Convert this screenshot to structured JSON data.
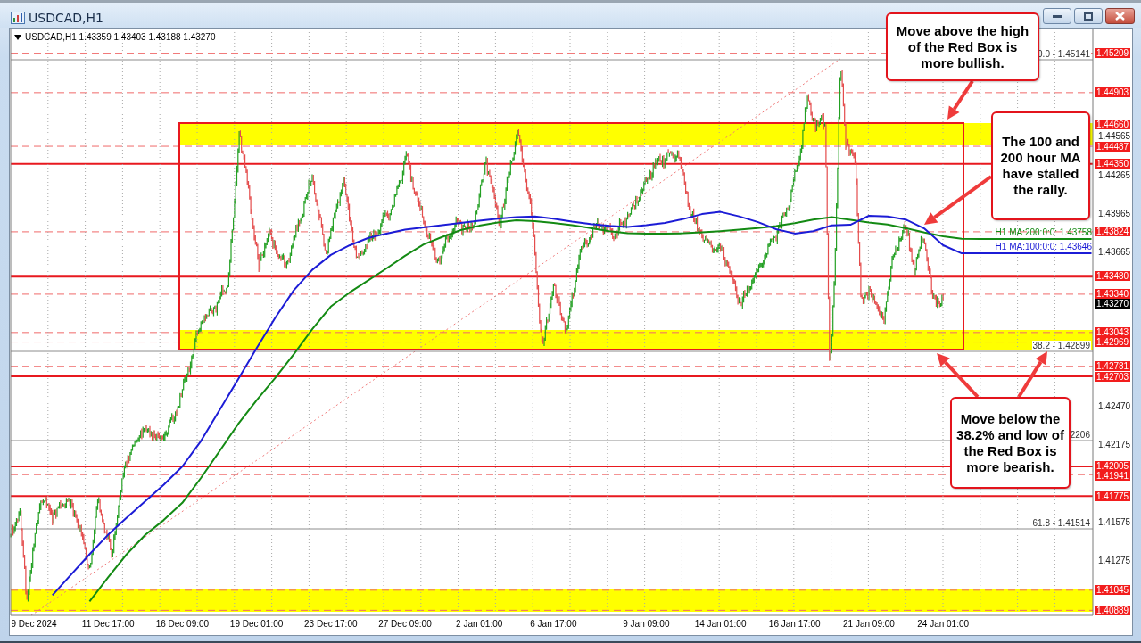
{
  "window": {
    "title": "USDCAD,H1"
  },
  "chart": {
    "info": "USDCAD,H1 1.43359 1.43403 1.43188 1.43270",
    "price_levels": [
      {
        "text": "1.45209",
        "kind": "dashed"
      },
      {
        "text": "1.44903",
        "kind": "dashed"
      },
      {
        "text": "1.44660",
        "kind": "marker"
      },
      {
        "text": "1.44487",
        "kind": "dashed"
      },
      {
        "text": "1.44350",
        "kind": "solid"
      },
      {
        "text": "1.43824",
        "kind": "dashed"
      },
      {
        "text": "1.43480",
        "kind": "thick"
      },
      {
        "text": "1.43340",
        "kind": "dashed"
      },
      {
        "text": "1.43270",
        "kind": "current"
      },
      {
        "text": "1.43043",
        "kind": "dashed"
      },
      {
        "text": "1.42969",
        "kind": "dashed"
      },
      {
        "text": "1.42781",
        "kind": "dashed"
      },
      {
        "text": "1.42703",
        "kind": "solid"
      },
      {
        "text": "1.42005",
        "kind": "solid"
      },
      {
        "text": "1.41941",
        "kind": "dashed"
      },
      {
        "text": "1.41775",
        "kind": "solid"
      },
      {
        "text": "1.41045",
        "kind": "dashed"
      },
      {
        "text": "1.40889",
        "kind": "dashed"
      }
    ],
    "fibonacci_levels": [
      "0.0 - 1.45141",
      "38.2 - 1.42899",
      "2206",
      "61.8 - 1.41514"
    ],
    "chart_data": {
      "type": "line",
      "grid": true,
      "ylim": [
        1.4085,
        1.454
      ],
      "categories": [
        "9 Dec 2024",
        null,
        null,
        null,
        "11 Dec 17:00",
        null,
        null,
        null,
        "16 Dec 09:00",
        null,
        null,
        null,
        "19 Dec 01:00",
        null,
        null,
        null,
        "23 Dec 17:00",
        null,
        null,
        null,
        "27 Dec 09:00",
        null,
        null,
        null,
        "2 Jan 01:00",
        null,
        null,
        null,
        "6 Jan 17:00",
        null,
        null,
        null,
        null,
        "9 Jan 09:00",
        null,
        null,
        null,
        "14 Jan 01:00",
        null,
        null,
        null,
        "16 Jan 17:00",
        null,
        null,
        null,
        "21 Jan 09:00",
        null,
        null,
        null,
        "24 Jan 01:00",
        null,
        null,
        null,
        null,
        null,
        null,
        null,
        null
      ],
      "yticks": [
        1.44565,
        1.44265,
        1.43965,
        1.43665,
        {
          "value": 1.4247,
          "label": "1.42470"
        },
        1.42175,
        1.41575,
        1.41275
      ],
      "series": [
        {
          "name": "H1 MA:200:0:0: 1.43758",
          "color": "#138a13",
          "values": [
            null,
            null,
            null,
            1.40958,
            1.41145,
            1.41324,
            1.41474,
            1.41589,
            1.41723,
            1.41915,
            1.42122,
            1.42332,
            1.42517,
            1.42691,
            1.42873,
            1.43068,
            1.43244,
            1.43352,
            1.43445,
            1.4354,
            1.43638,
            1.43726,
            1.43784,
            1.43837,
            1.43871,
            1.43895,
            1.43913,
            1.43907,
            1.43893,
            1.43876,
            1.43853,
            1.43829,
            1.43812,
            1.4381,
            1.4381,
            1.43812,
            1.43819,
            1.43828,
            1.4384,
            1.43853,
            1.43868,
            1.43891,
            1.43918,
            1.43938,
            1.43917,
            1.43897,
            1.4388,
            1.43852,
            1.43818,
            1.43789,
            1.4377,
            1.43768,
            1.43768,
            1.43768,
            1.43768,
            1.43768,
            1.43768,
            1.43768
          ]
        },
        {
          "name": "H1 MA:100:0:0: 1.43646",
          "color": "#1c1cd6",
          "values": [
            null,
            1.41007,
            1.41165,
            1.41324,
            1.41475,
            1.41607,
            1.41735,
            1.41863,
            1.42005,
            1.42201,
            1.4244,
            1.4268,
            1.4292,
            1.43156,
            1.4337,
            1.43529,
            1.43644,
            1.43718,
            1.43775,
            1.4381,
            1.4384,
            1.43858,
            1.43875,
            1.43892,
            1.43909,
            1.43925,
            1.43937,
            1.43942,
            1.43925,
            1.43903,
            1.43884,
            1.4387,
            1.43862,
            1.43875,
            1.43893,
            1.43923,
            1.43961,
            1.43978,
            1.43944,
            1.439,
            1.43844,
            1.4381,
            1.43828,
            1.43874,
            1.43878,
            1.43948,
            1.43943,
            1.43918,
            1.43848,
            1.4372,
            1.43657,
            1.43657,
            1.43657,
            1.43657,
            1.43657,
            1.43657,
            1.43657,
            1.43657
          ]
        }
      ]
    },
    "callouts": [
      "Move above the high of the Red Box is more bullish.",
      "The 100 and 200 hour MA have stalled the rally.",
      "Move below the 38.2% and low of the Red Box is more bearish."
    ]
  }
}
